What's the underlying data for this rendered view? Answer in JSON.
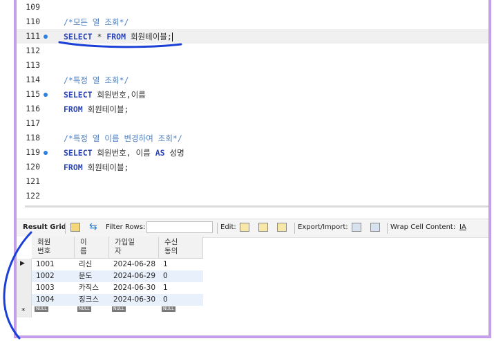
{
  "editor": {
    "lines": [
      {
        "num": "109",
        "segments": [],
        "dot": false,
        "current": false
      },
      {
        "num": "110",
        "segments": [
          {
            "text": "/*모든 열 조회*/",
            "kind": "comment"
          }
        ],
        "dot": false,
        "current": false
      },
      {
        "num": "111",
        "segments": [
          {
            "text": "SELECT",
            "kind": "kw"
          },
          {
            "text": " * ",
            "kind": "tx"
          },
          {
            "text": "FROM",
            "kind": "kw"
          },
          {
            "text": " 회원테이블;",
            "kind": "tx"
          }
        ],
        "dot": true,
        "current": true
      },
      {
        "num": "112",
        "segments": [],
        "dot": false,
        "current": false
      },
      {
        "num": "113",
        "segments": [],
        "dot": false,
        "current": false
      },
      {
        "num": "114",
        "segments": [
          {
            "text": "/*특정 열 조회*/",
            "kind": "comment"
          }
        ],
        "dot": false,
        "current": false
      },
      {
        "num": "115",
        "segments": [
          {
            "text": "SELECT",
            "kind": "kw"
          },
          {
            "text": " 회원번호,이름",
            "kind": "tx"
          }
        ],
        "dot": true,
        "current": false
      },
      {
        "num": "116",
        "segments": [
          {
            "text": "FROM",
            "kind": "kw"
          },
          {
            "text": " 회원테이블;",
            "kind": "tx"
          }
        ],
        "dot": false,
        "current": false
      },
      {
        "num": "117",
        "segments": [],
        "dot": false,
        "current": false
      },
      {
        "num": "118",
        "segments": [
          {
            "text": "/*특정 열 이름 변경하여 조회*/",
            "kind": "comment"
          }
        ],
        "dot": false,
        "current": false
      },
      {
        "num": "119",
        "segments": [
          {
            "text": "SELECT",
            "kind": "kw"
          },
          {
            "text": " 회원번호, 이름 ",
            "kind": "tx"
          },
          {
            "text": "AS",
            "kind": "kw"
          },
          {
            "text": " 성명",
            "kind": "tx"
          }
        ],
        "dot": true,
        "current": false
      },
      {
        "num": "120",
        "segments": [
          {
            "text": "FROM",
            "kind": "kw"
          },
          {
            "text": " 회원테이블;",
            "kind": "tx"
          }
        ],
        "dot": false,
        "current": false
      },
      {
        "num": "121",
        "segments": [],
        "dot": false,
        "current": false
      },
      {
        "num": "122",
        "segments": [],
        "dot": false,
        "current": false
      }
    ]
  },
  "toolbar": {
    "result_grid": "Result Grid",
    "filter_rows": "Filter Rows:",
    "filter_value": "",
    "edit": "Edit:",
    "export_import": "Export/Import:",
    "wrap_cell": "Wrap Cell Content:"
  },
  "grid": {
    "headers": [
      "회원\n번호",
      "이\n름",
      "가입일\n자",
      "수신\n동의"
    ],
    "rows": [
      [
        "1001",
        "리신",
        "2024-06-28",
        "1"
      ],
      [
        "1002",
        "문도",
        "2024-06-29",
        "0"
      ],
      [
        "1003",
        "카직스",
        "2024-06-30",
        "1"
      ],
      [
        "1004",
        "징크스",
        "2024-06-30",
        "0"
      ]
    ],
    "null_label": "NULL",
    "new_row_marker": "*"
  },
  "colors": {
    "frame": "#c49ee8",
    "annotation": "#1a3fd6",
    "keyword": "#2b44b8",
    "comment": "#4f7fbf",
    "alt_row": "#e8f0fb"
  }
}
